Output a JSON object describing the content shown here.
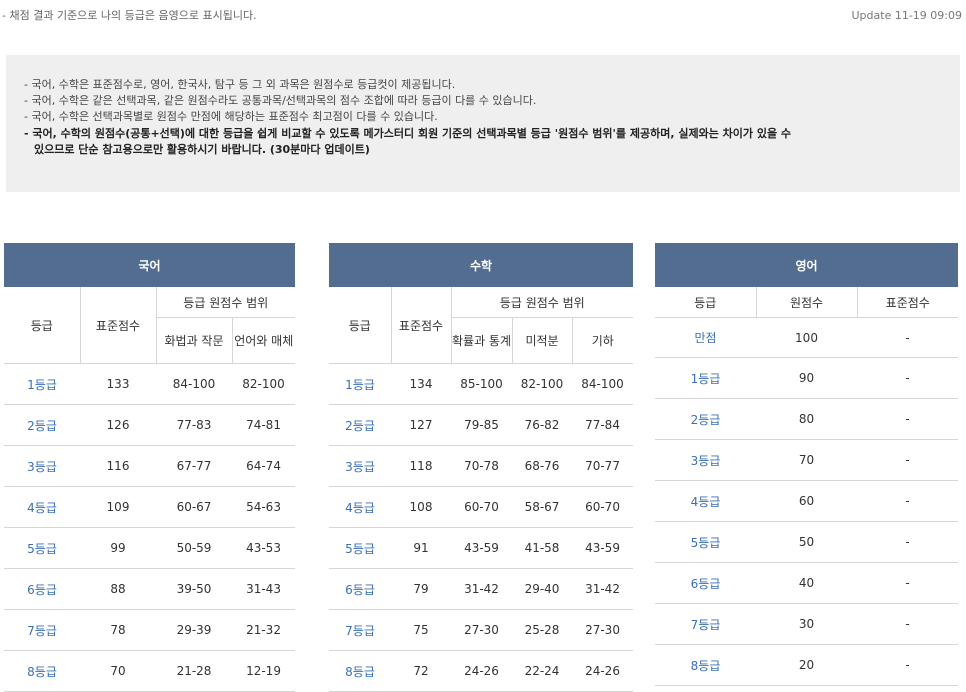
{
  "top_note": "- 채점 결과 기준으로 나의 등급은 음영으로 표시됩니다.",
  "update": "Update 11-19 09:09",
  "notices": [
    "- 국어, 수학은 표준점수로, 영어, 한국사, 탐구 등 그 외 과목은 원점수로 등급컷이 제공됩니다.",
    "- 국어, 수학은 같은 선택과목, 같은 원점수라도 공통과목/선택과목의 점수 조합에 따라 등급이 다를 수 있습니다.",
    "- 국어, 수학은 선택과목별로 원점수 만점에 해당하는 표준점수 최고점이 다를 수 있습니다.",
    "- 국어, 수학의 원점수(공통+선택)에 대한 등급을 쉽게 비교할 수 있도록 메가스터디 회원 기준의 선택과목별 등급 '원점수 범위'를 제공하며, 실제와는 차이가 있을 수",
    "있으므로 단순 참고용으로만 활용하시기 바랍니다. (30분마다 업데이트)"
  ],
  "korean": {
    "title": "국어",
    "col_grade": "등급",
    "col_std": "표준점수",
    "col_range": "등급 원점수 범위",
    "sub1": "화법과 작문",
    "sub2": "언어와 매체",
    "rows": [
      {
        "grade": "1등급",
        "std": "133",
        "r1": "84-100",
        "r2": "82-100"
      },
      {
        "grade": "2등급",
        "std": "126",
        "r1": "77-83",
        "r2": "74-81"
      },
      {
        "grade": "3등급",
        "std": "116",
        "r1": "67-77",
        "r2": "64-74"
      },
      {
        "grade": "4등급",
        "std": "109",
        "r1": "60-67",
        "r2": "54-63"
      },
      {
        "grade": "5등급",
        "std": "99",
        "r1": "50-59",
        "r2": "43-53"
      },
      {
        "grade": "6등급",
        "std": "88",
        "r1": "39-50",
        "r2": "31-43"
      },
      {
        "grade": "7등급",
        "std": "78",
        "r1": "29-39",
        "r2": "21-32"
      },
      {
        "grade": "8등급",
        "std": "70",
        "r1": "21-28",
        "r2": "12-19"
      }
    ]
  },
  "math": {
    "title": "수학",
    "col_grade": "등급",
    "col_std": "표준점수",
    "col_range": "등급 원점수 범위",
    "sub1": "확률과 통계",
    "sub2": "미적분",
    "sub3": "기하",
    "rows": [
      {
        "grade": "1등급",
        "std": "134",
        "r1": "85-100",
        "r2": "82-100",
        "r3": "84-100"
      },
      {
        "grade": "2등급",
        "std": "127",
        "r1": "79-85",
        "r2": "76-82",
        "r3": "77-84"
      },
      {
        "grade": "3등급",
        "std": "118",
        "r1": "70-78",
        "r2": "68-76",
        "r3": "70-77"
      },
      {
        "grade": "4등급",
        "std": "108",
        "r1": "60-70",
        "r2": "58-67",
        "r3": "60-70"
      },
      {
        "grade": "5등급",
        "std": "91",
        "r1": "43-59",
        "r2": "41-58",
        "r3": "43-59"
      },
      {
        "grade": "6등급",
        "std": "79",
        "r1": "31-42",
        "r2": "29-40",
        "r3": "31-42"
      },
      {
        "grade": "7등급",
        "std": "75",
        "r1": "27-30",
        "r2": "25-28",
        "r3": "27-30"
      },
      {
        "grade": "8등급",
        "std": "72",
        "r1": "24-26",
        "r2": "22-24",
        "r3": "24-26"
      }
    ]
  },
  "english": {
    "title": "영어",
    "col_grade": "등급",
    "col_raw": "원점수",
    "col_std": "표준점수",
    "rows": [
      {
        "grade": "만점",
        "raw": "100",
        "std": "-"
      },
      {
        "grade": "1등급",
        "raw": "90",
        "std": "-"
      },
      {
        "grade": "2등급",
        "raw": "80",
        "std": "-"
      },
      {
        "grade": "3등급",
        "raw": "70",
        "std": "-"
      },
      {
        "grade": "4등급",
        "raw": "60",
        "std": "-"
      },
      {
        "grade": "5등급",
        "raw": "50",
        "std": "-"
      },
      {
        "grade": "6등급",
        "raw": "40",
        "std": "-"
      },
      {
        "grade": "7등급",
        "raw": "30",
        "std": "-"
      },
      {
        "grade": "8등급",
        "raw": "20",
        "std": "-"
      }
    ]
  }
}
